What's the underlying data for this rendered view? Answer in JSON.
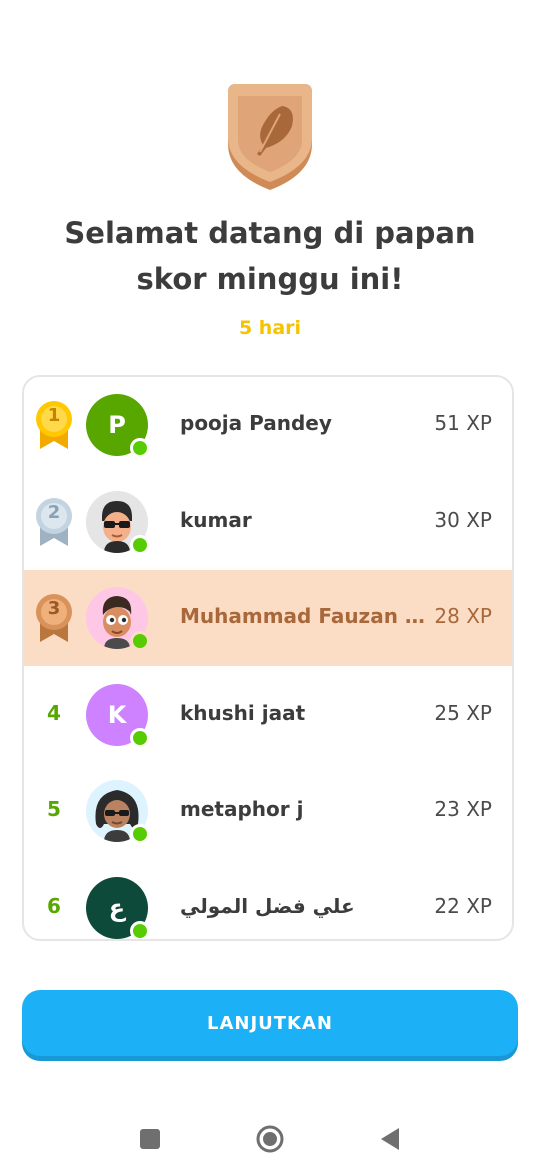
{
  "header": {
    "title": "Selamat datang di papan skor minggu ini!",
    "subtitle": "5 hari"
  },
  "leaderboard": {
    "rows": [
      {
        "rank": "1",
        "medal": "gold",
        "avatar_type": "letter",
        "avatar_letter": "P",
        "avatar_color": "#58a700",
        "name": "pooja Pandey",
        "xp": "51 XP",
        "me": false
      },
      {
        "rank": "2",
        "medal": "silver",
        "avatar_type": "face-sunglasses",
        "avatar_letter": "",
        "avatar_color": "#e5e5e5",
        "name": "kumar",
        "xp": "30 XP",
        "me": false
      },
      {
        "rank": "3",
        "medal": "bronze",
        "avatar_type": "face-boy",
        "avatar_letter": "",
        "avatar_color": "#ffc7e6",
        "name": "Muhammad Fauzan A...",
        "xp": "28 XP",
        "me": true
      },
      {
        "rank": "4",
        "medal": "",
        "avatar_type": "letter",
        "avatar_letter": "K",
        "avatar_color": "#ce82ff",
        "name": "khushi jaat",
        "xp": "25 XP",
        "me": false
      },
      {
        "rank": "5",
        "medal": "",
        "avatar_type": "face-curly",
        "avatar_letter": "",
        "avatar_color": "#ddf4ff",
        "name": "metaphor j",
        "xp": "23 XP",
        "me": false
      },
      {
        "rank": "6",
        "medal": "",
        "avatar_type": "letter",
        "avatar_letter": "ع",
        "avatar_color": "#0e4a3a",
        "name": "علي فضل المولي",
        "xp": "22 XP",
        "me": false
      }
    ]
  },
  "continue_button": {
    "label": "LANJUTKAN"
  },
  "colors": {
    "accent": "#1cb0f6",
    "highlight_row": "#fbdcc5",
    "online": "#58cc02",
    "subtitle": "#f7c300"
  },
  "icons": {
    "league_badge": "bronze-feather-badge-icon",
    "nav_recents": "square-icon",
    "nav_home": "circle-icon",
    "nav_back": "triangle-back-icon"
  }
}
